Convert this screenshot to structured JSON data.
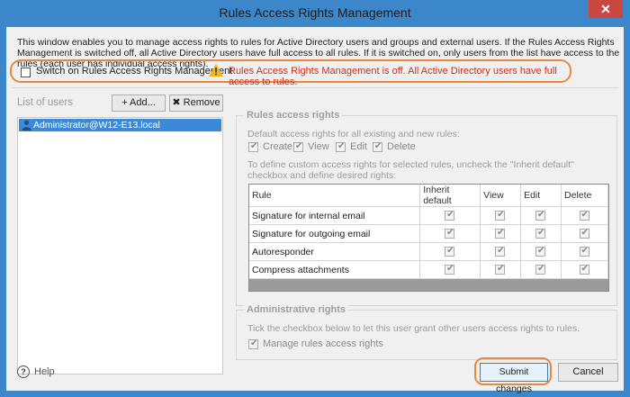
{
  "window": {
    "title": "Rules Access Rights Management",
    "close_symbol": "✕"
  },
  "intro_text": "This window enables you to manage access rights to rules for Active Directory users and groups and external users. If the Rules Access Rights Management is switched off, all Active Directory users have full access to all rules. If it is switched on, only users from the list have access to the rules (each user has individual access rights).",
  "switch": {
    "label": "Switch on Rules Access Rights Management",
    "checked": false,
    "warning": "Rules Access Rights Management is off. All Active Directory users have full access to rules.",
    "warning_icon": "warning-triangle-icon",
    "warning_color": "#c8311f"
  },
  "users": {
    "label": "List of users",
    "add_label": "+ Add...",
    "remove_label": "✖ Remove",
    "items": [
      "Administrator@W12-E13.local"
    ]
  },
  "rules_rights": {
    "title": "Rules access rights",
    "default_text": "Default access rights for all existing and new rules:",
    "defaults": [
      "Create",
      "View",
      "Edit",
      "Delete"
    ],
    "custom_text": "To define custom access rights for selected rules, uncheck the \"Inherit default\" checkbox and define desired rights:",
    "columns": [
      "Rule",
      "Inherit default",
      "View",
      "Edit",
      "Delete"
    ],
    "rows": [
      {
        "rule": "Signature for internal email"
      },
      {
        "rule": "Signature for outgoing email"
      },
      {
        "rule": "Autoresponder"
      },
      {
        "rule": "Compress attachments"
      }
    ]
  },
  "admin_rights": {
    "title": "Administrative rights",
    "text": "Tick the checkbox below to let this user grant other users access rights to rules.",
    "checkbox_label": "Manage rules access rights"
  },
  "footer": {
    "help_label": "Help",
    "submit_label": "Submit changes",
    "cancel_label": "Cancel"
  },
  "colors": {
    "titlebar": "#3c87c9",
    "highlight_ring": "#e7883e",
    "selection": "#3b8ad9"
  }
}
